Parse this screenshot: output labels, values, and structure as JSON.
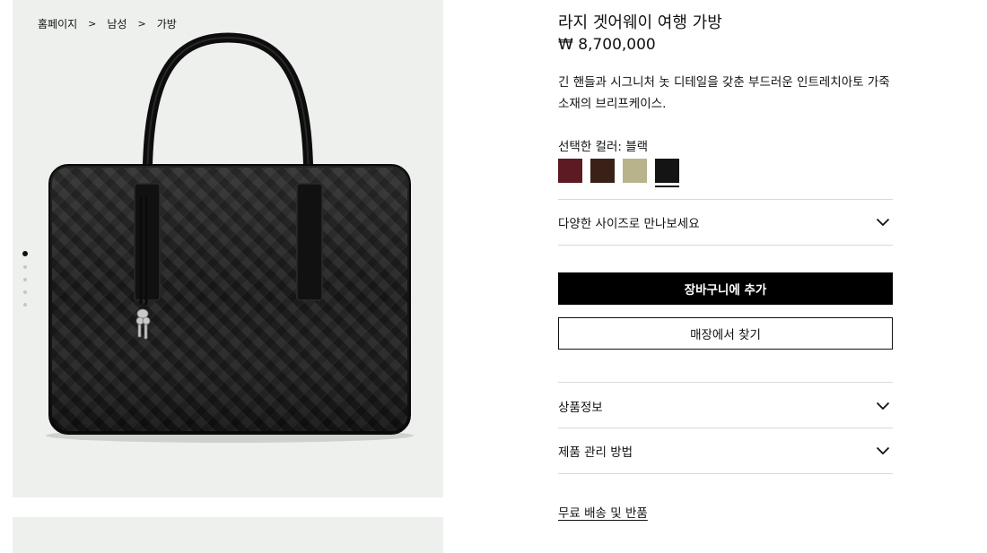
{
  "breadcrumb": [
    {
      "label": "홈페이지"
    },
    {
      "label": "남성"
    },
    {
      "label": "가방"
    }
  ],
  "breadcrumb_separator": ">",
  "gallery": {
    "slide_count": 5,
    "active_index": 0,
    "image_alt_icon": "woven-leather-briefcase-image"
  },
  "product": {
    "title": "라지 겟어웨이 여행 가방",
    "price": "₩ 8,700,000",
    "description": "긴 핸들과 시그니처 놋 디테일을 갖춘 부드러운 인트레치아토 가죽 소재의 브리프케이스.",
    "color_label": "선택한 컬러: 블랙",
    "swatches": [
      {
        "color": "#5e1a22",
        "selected": false
      },
      {
        "color": "#3a2118",
        "selected": false
      },
      {
        "color": "#b9b38b",
        "selected": false
      },
      {
        "color": "#141414",
        "selected": true
      }
    ]
  },
  "size_row": {
    "label": "다양한 사이즈로 만나보세요",
    "icon": "chevron-down-icon"
  },
  "actions": {
    "add_to_cart": "장바구니에 추가",
    "find_in_store": "매장에서 찾기"
  },
  "accordion": [
    {
      "label": "상품정보",
      "icon": "chevron-down-icon"
    },
    {
      "label": "제품 관리 방법",
      "icon": "chevron-down-icon"
    }
  ],
  "shipping_link": "무료 배송 및 반품"
}
